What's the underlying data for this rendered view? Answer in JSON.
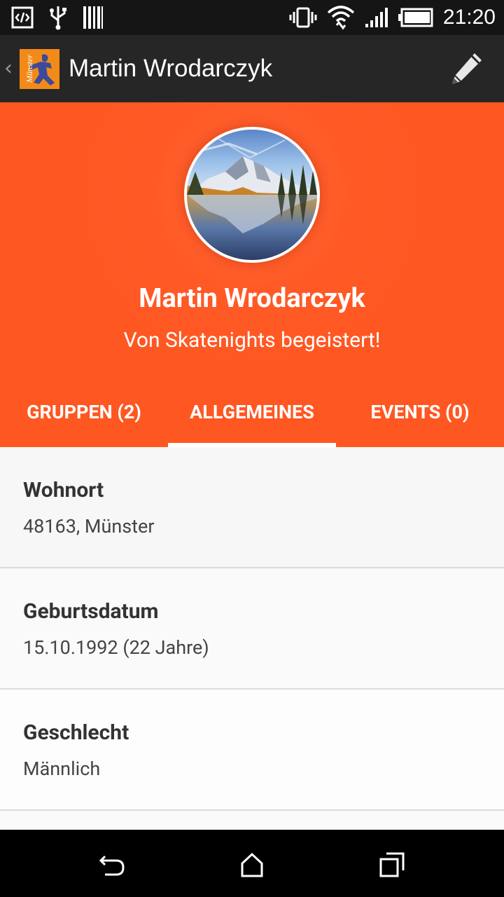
{
  "status_bar": {
    "time": "21:20",
    "icons": [
      "code-icon",
      "usb-icon",
      "barcode-icon",
      "vibrate-icon",
      "wifi-icon",
      "signal-icon",
      "battery-icon"
    ]
  },
  "action_bar": {
    "back_glyph": "‹",
    "logo_text": "Münster",
    "title": "Martin Wrodarczyk",
    "edit_icon": "pencil-icon"
  },
  "profile": {
    "name": "Martin Wrodarczyk",
    "motto": "Von Skatenights begeistert!"
  },
  "tabs": [
    {
      "label": "GRUPPEN (2)",
      "selected": false
    },
    {
      "label": "ALLGEMEINES",
      "selected": true
    },
    {
      "label": "EVENTS (0)",
      "selected": false
    }
  ],
  "details": [
    {
      "label": "Wohnort",
      "value": "48163, Münster"
    },
    {
      "label": "Geburtsdatum",
      "value": "15.10.1992 (22 Jahre)"
    },
    {
      "label": "Geschlecht",
      "value": "Männlich"
    }
  ],
  "colors": {
    "accent": "#ff5722",
    "action_bar": "#262626",
    "status_bar": "#151515"
  }
}
